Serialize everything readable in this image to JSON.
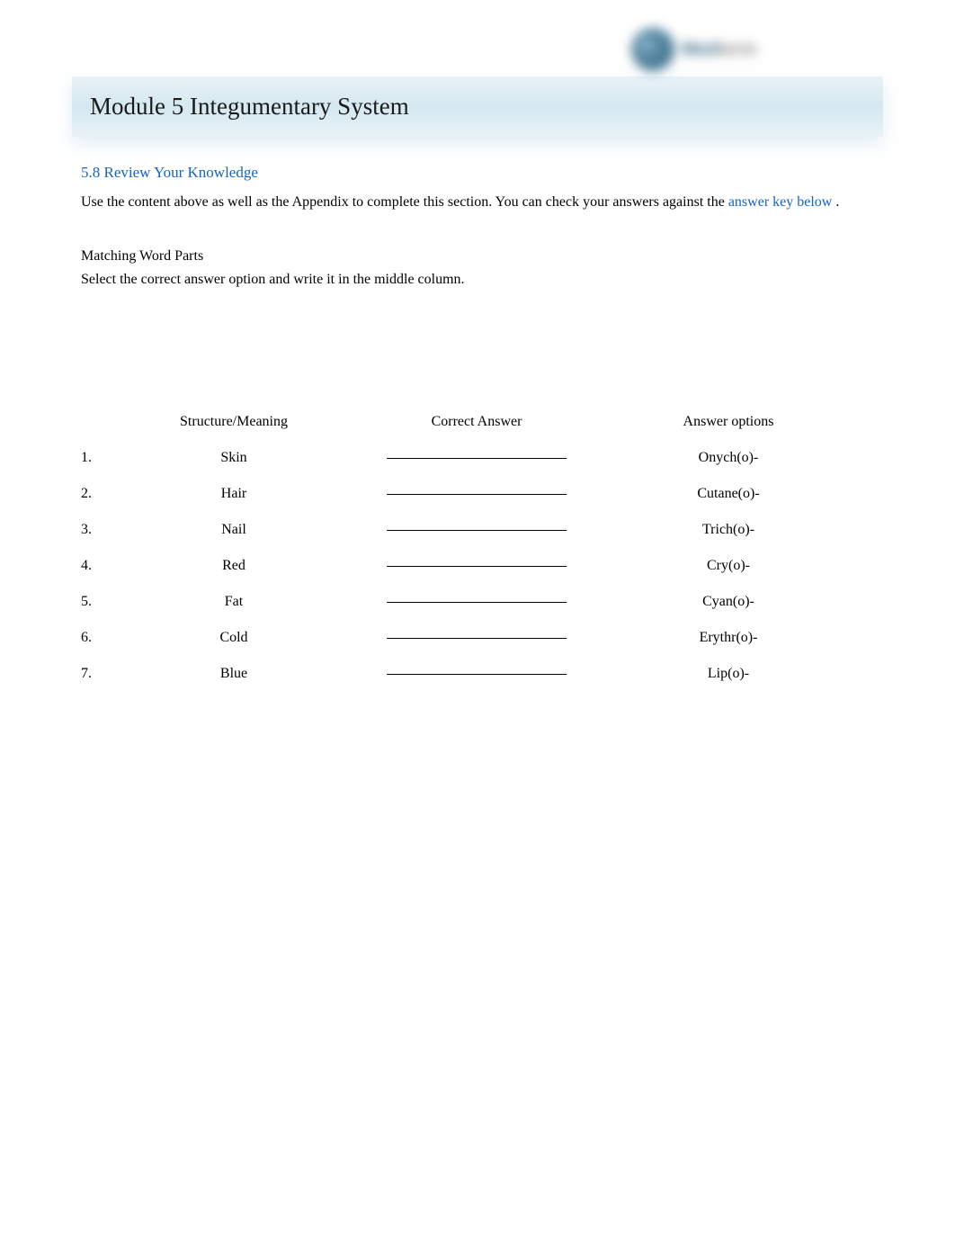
{
  "module_title": "Module 5 Integumentary System",
  "section": {
    "heading": "5.8 Review Your Knowledge",
    "instructions_prefix": "Use the content above as well as the Appendix to complete this section. You can check your answers against the ",
    "link_text": "answer key below",
    "instructions_suffix": " ."
  },
  "matching": {
    "title": "Matching Word Parts",
    "instructions": "Select the correct answer option and write it in the middle column.",
    "headers": {
      "structure": "Structure/Meaning",
      "correct": "Correct Answer",
      "options": "Answer options"
    },
    "rows": [
      {
        "num": "1.",
        "structure": "Skin",
        "option": "Onych(o)-"
      },
      {
        "num": "2.",
        "structure": "Hair",
        "option": "Cutane(o)-"
      },
      {
        "num": "3.",
        "structure": "Nail",
        "option": "Trich(o)-"
      },
      {
        "num": "4.",
        "structure": "Red",
        "option": "Cry(o)-"
      },
      {
        "num": "5.",
        "structure": "Fat",
        "option": "Cyan(o)-"
      },
      {
        "num": "6.",
        "structure": "Cold",
        "option": "Erythr(o)-"
      },
      {
        "num": "7.",
        "structure": "Blue",
        "option": "Lip(o)-"
      }
    ]
  }
}
